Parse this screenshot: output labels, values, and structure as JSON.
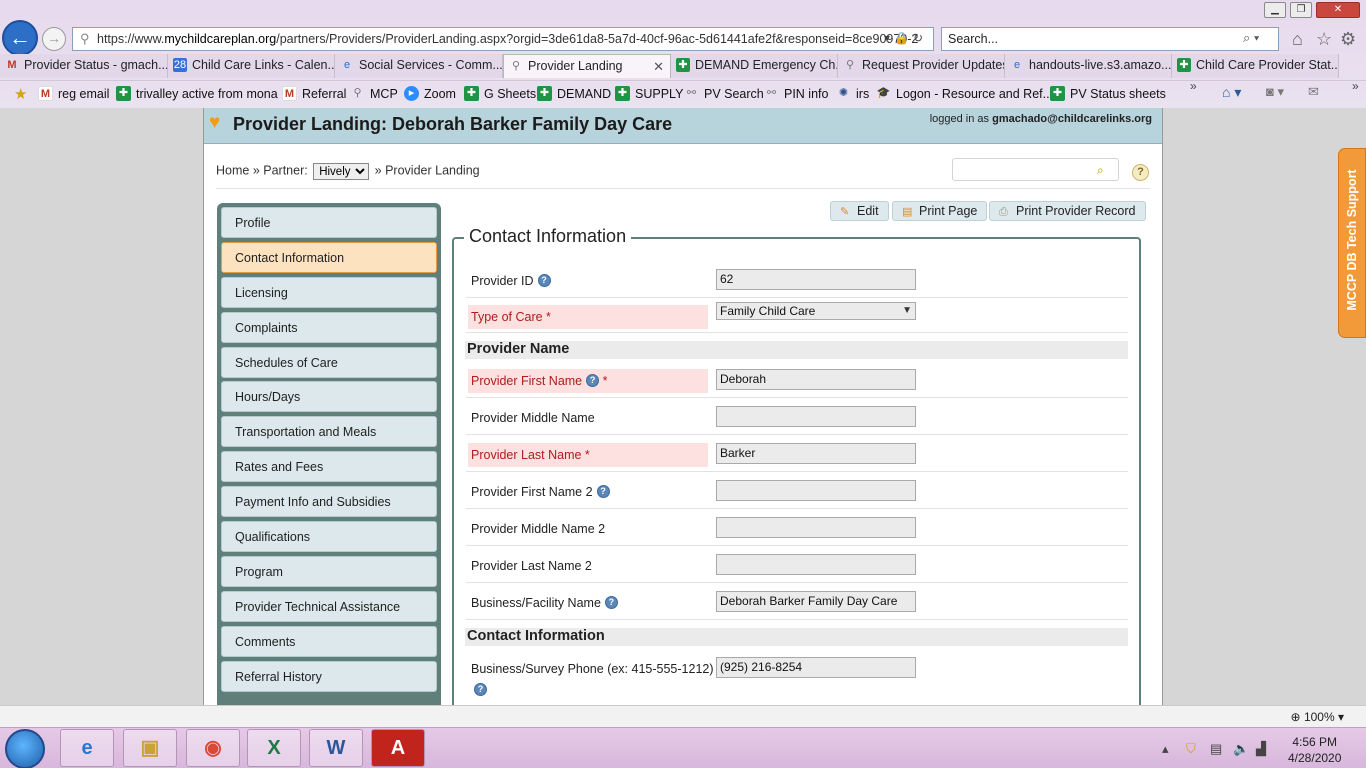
{
  "browser": {
    "url_prefix": "https://www.",
    "url_host": "mychildcareplan.org",
    "url_rest": "/partners/Providers/ProviderLanding.aspx?orgid=3de61da8-5a7d-40cf-96ac-5d61441afe2f&responseid=8ce90970-2",
    "search_placeholder": "Search...",
    "tabs": [
      {
        "label": "Provider Status - gmach...",
        "icon": "gmail-icon"
      },
      {
        "label": "Child Care Links - Calen...",
        "icon": "calendar-icon"
      },
      {
        "label": "Social Services - Comm...",
        "icon": "ie-icon"
      },
      {
        "label": "Provider Landing",
        "icon": "page-icon",
        "active": true
      },
      {
        "label": "DEMAND Emergency Ch...",
        "icon": "sheets-icon"
      },
      {
        "label": "Request Provider Updates",
        "icon": "page-icon"
      },
      {
        "label": "handouts-live.s3.amazo...",
        "icon": "ie-icon"
      },
      {
        "label": "Child Care Provider Stat...",
        "icon": "sheets-icon"
      }
    ],
    "favorites": [
      {
        "label": "reg email",
        "icon": "gmail-icon"
      },
      {
        "label": "trivalley active from mona",
        "icon": "sheets-icon"
      },
      {
        "label": "Referral",
        "icon": "gmail-icon"
      },
      {
        "label": "MCP",
        "icon": "page-icon"
      },
      {
        "label": "Zoom",
        "icon": "zoom-icon"
      },
      {
        "label": "G Sheets",
        "icon": "sheets-icon"
      },
      {
        "label": "DEMAND",
        "icon": "sheets-icon"
      },
      {
        "label": "SUPPLY",
        "icon": "sheets-icon"
      },
      {
        "label": "PV Search",
        "icon": "link-icon"
      },
      {
        "label": "PIN info",
        "icon": "link-icon"
      },
      {
        "label": "irs",
        "icon": "seal-icon"
      },
      {
        "label": "Logon - Resource and Ref...",
        "icon": "graduation-cap-icon"
      },
      {
        "label": "PV Status sheets",
        "icon": "sheets-icon"
      }
    ],
    "zoom": "100%"
  },
  "page": {
    "title": "Provider Landing: Deborah Barker Family Day Care",
    "logged_in_prefix": "logged in as ",
    "logged_in_user": "gmachado@childcarelinks.org",
    "breadcrumb": {
      "home": "Home",
      "sep1": " » Partner: ",
      "partner_value": "Hively",
      "sep2": " » ",
      "current": "Provider Landing"
    },
    "help": "?",
    "nav": [
      "Profile",
      "Contact Information",
      "Licensing",
      "Complaints",
      "Schedules of Care",
      "Hours/Days",
      "Transportation and Meals",
      "Rates and Fees",
      "Payment Info and Subsidies",
      "Qualifications",
      "Program",
      "Provider Technical Assistance",
      "Comments",
      "Referral History"
    ],
    "buttons": {
      "edit": "Edit",
      "print_page": "Print Page",
      "print_record": "Print Provider Record"
    },
    "section_title": "Contact Information",
    "fields": {
      "provider_id": {
        "label": "Provider ID",
        "value": "62"
      },
      "type_of_care": {
        "label": "Type of Care *",
        "value": "Family Child Care"
      },
      "first_name": {
        "label": "Provider First Name",
        "req": " *",
        "value": "Deborah"
      },
      "middle_name": {
        "label": "Provider Middle Name",
        "value": ""
      },
      "last_name": {
        "label": "Provider Last Name *",
        "value": "Barker"
      },
      "first_name_2": {
        "label": "Provider First Name 2",
        "value": ""
      },
      "middle_name_2": {
        "label": "Provider Middle Name 2",
        "value": ""
      },
      "last_name_2": {
        "label": "Provider Last Name 2",
        "value": ""
      },
      "business_name": {
        "label": "Business/Facility Name",
        "value": "Deborah Barker Family Day Care"
      },
      "phone": {
        "label": "Business/Survey Phone (ex: 415-555-1212)",
        "value": "(925) 216-8254"
      }
    },
    "subsections": {
      "provider_name": "Provider Name",
      "contact_info": "Contact Information"
    },
    "side_tab": "MCCP DB Tech Support"
  },
  "taskbar": {
    "time": "4:56 PM",
    "date": "4/28/2020"
  },
  "colors": {
    "accent_orange": "#f29a3a",
    "nav_bg": "#5f7f7b",
    "header_bg": "#b7d3dc"
  }
}
